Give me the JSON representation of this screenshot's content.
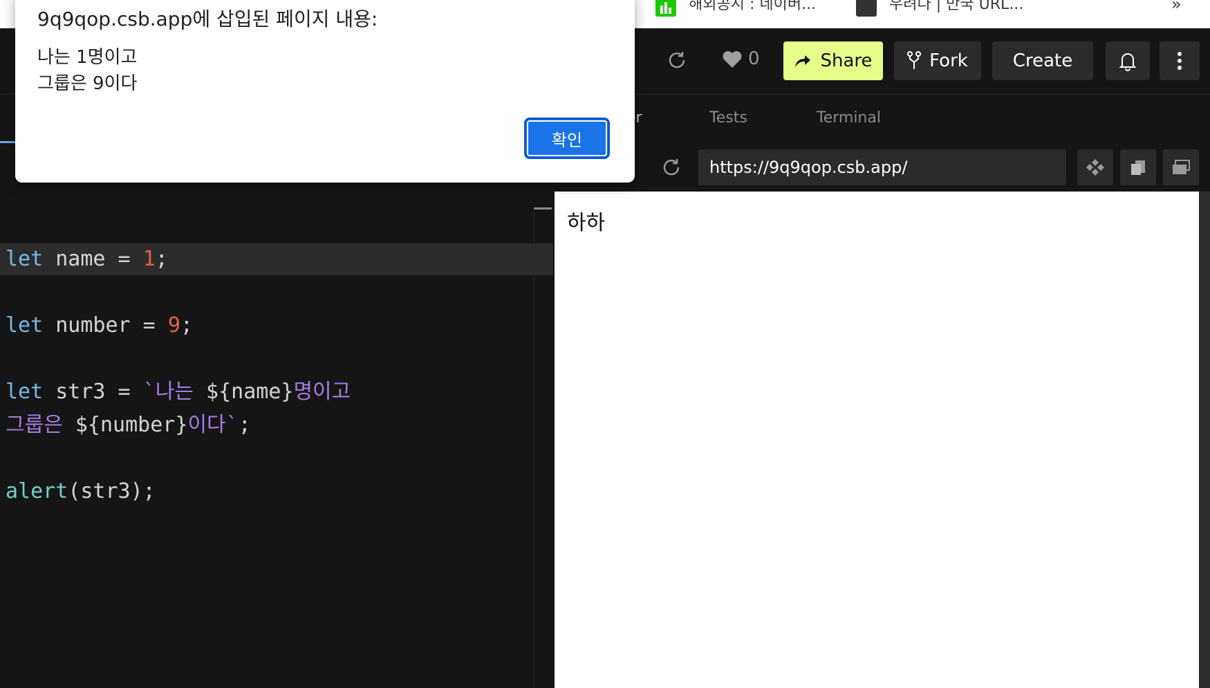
{
  "browser": {
    "bookmarks": [
      {
        "label": "해외공시 : 네이버...",
        "icon": "chart-icon",
        "color": "#1ec800"
      },
      {
        "label": "우려다 | 만국 URL...",
        "icon": "site-icon",
        "color": "#333333"
      }
    ],
    "more_label": "»"
  },
  "header": {
    "likes": "0",
    "share_label": "Share",
    "fork_label": "Fork",
    "create_label": "Create",
    "accent": "#e5ff8a"
  },
  "tabs": {
    "browser_partial": "er",
    "tests": "Tests",
    "terminal": "Terminal"
  },
  "address": {
    "url": "https://9q9qop.csb.app/"
  },
  "editor": {
    "lines": [
      {
        "kw": "let",
        "rest": " name = ",
        "num": "1",
        "end": ";"
      },
      {
        "kw": "let",
        "rest": " number = ",
        "num": "9",
        "end": ";"
      },
      {
        "kw": "let",
        "rest": " str3 = ",
        "str_a": "`나는 ",
        "tpl_a": "${name}",
        "str_b": "명이고"
      },
      {
        "str_c": "그룹은 ",
        "tpl_b": "${number}",
        "str_d": "이다`",
        "end": ";"
      },
      {
        "fn": "alert",
        "rest": "(str3);"
      }
    ]
  },
  "preview": {
    "text": "하하"
  },
  "alert": {
    "title": "9q9qop.csb.app에 삽입된 페이지 내용:",
    "message_line1": "나는 1명이고",
    "message_line2": "그룹은 9이다",
    "ok_label": "확인"
  }
}
